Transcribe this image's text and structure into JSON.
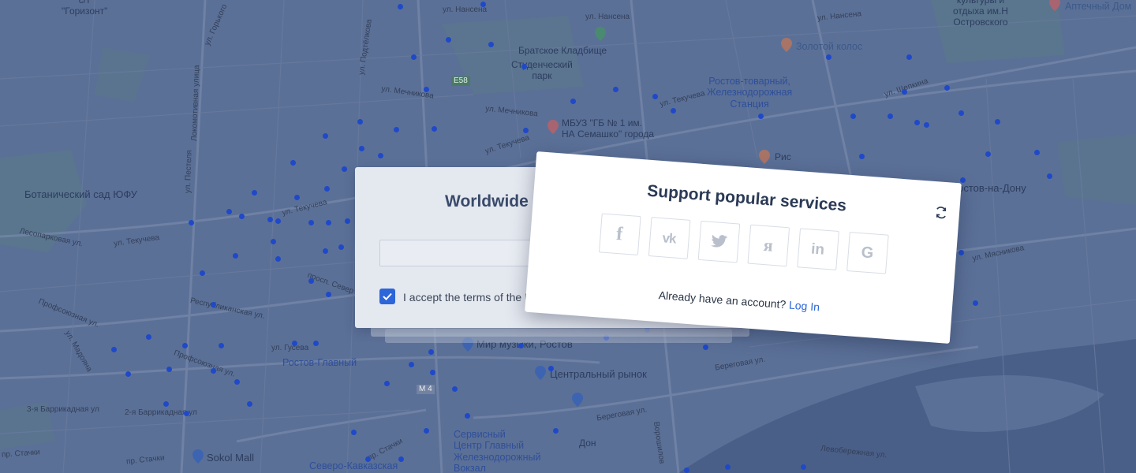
{
  "map": {
    "labels": {
      "ceb": "с/т\n\"Горизонт\"",
      "culture": "культуры и\nотдыха им.Н\nОстровского",
      "pharmacy": "Аптечный Дом",
      "cemetery": "Братское Кладбище",
      "student_park": "Студенческий\nпарк",
      "zolotoy": "Золотой колос",
      "rostov_tov": "Ростов-товарный,\nЖелезнодорожная\nСтанция",
      "mbuz": "МБУЗ \"ГБ № 1 им.\nНА Семашко\" города",
      "ris": "Рис",
      "botanical": "Ботанический сад ЮФУ",
      "rostov_na_donu": "Ростов-на-Дону",
      "mir_muzyki": "Мир музыки, Ростов",
      "rostov_glavny": "Ростов-Главный",
      "central_market": "Центральный рынок",
      "sokol_mall": "Sokol Mall",
      "service_center": "Сервисный\nЦентр Главный\nЖелезнодорожный\nВокзал",
      "severo": "Северо-Кавказская",
      "don": "Дон"
    },
    "streets": {
      "nanseva1": "ул. Нансена",
      "nanseva2": "ул. Нансена",
      "nanseva3": "ул. Нансена",
      "mechnikova1": "ул. Мечникова",
      "mechnikova2": "ул. Мечникова",
      "tekucheva1": "ул. Текучева",
      "tekucheva2": "ул. Текучева",
      "tekucheva3": "ул. Текучева",
      "tekucheva4": "ул. Текучева",
      "shchepkina": "ул. Щепкина",
      "lokomotivnaya": "Локомотивная улица",
      "pestelya": "ул. Пестеля",
      "lesoparkovaya": "Лесопарковая ул.",
      "profsoyuznaya1": "Профсоюзная ул.",
      "profsoyuznaya2": "Профсоюзная ул.",
      "respublikanskaya": "Республиканская ул.",
      "gusev": "ул. Гусева",
      "madoyana": "ул. Мадояна",
      "barrikadnaya3": "3-я Баррикадная ул",
      "barrikadnaya2": "2-я Баррикадная ул",
      "stachki1": "пр. Стачки",
      "stachki2": "пр. Стачки",
      "stachki3": "пр. Стачки",
      "beregovaya1": "Береговая ул.",
      "beregovaya2": "Береговая ул.",
      "levoberezhnaya": "Левобережная ул.",
      "voroshilova": "Ворошилов",
      "masnikova": "ул. Мясникова",
      "sever": "просп. Север",
      "podtelkova": "ул. Подтёлкова",
      "tekst_gorky": "ул. Горького",
      "m4": "М 4",
      "e58": "E58"
    }
  },
  "back_card": {
    "title": "Worldwide s",
    "checkbox_checked": true,
    "terms_text": "I accept the terms of the U"
  },
  "front_card": {
    "title": "Support popular services",
    "refresh_icon": "refresh-icon",
    "services": [
      {
        "name": "facebook",
        "glyph": "f"
      },
      {
        "name": "vk",
        "glyph": "vk"
      },
      {
        "name": "twitter",
        "glyph": "twitter"
      },
      {
        "name": "yandex",
        "glyph": "я"
      },
      {
        "name": "linkedin",
        "glyph": "in"
      },
      {
        "name": "google",
        "glyph": "G"
      }
    ],
    "account_text": "Already have an account?",
    "login_label": "Log In"
  },
  "colors": {
    "accent": "#2c66d8",
    "map_bg": "#5a6f96",
    "dot": "#1f49c9"
  }
}
